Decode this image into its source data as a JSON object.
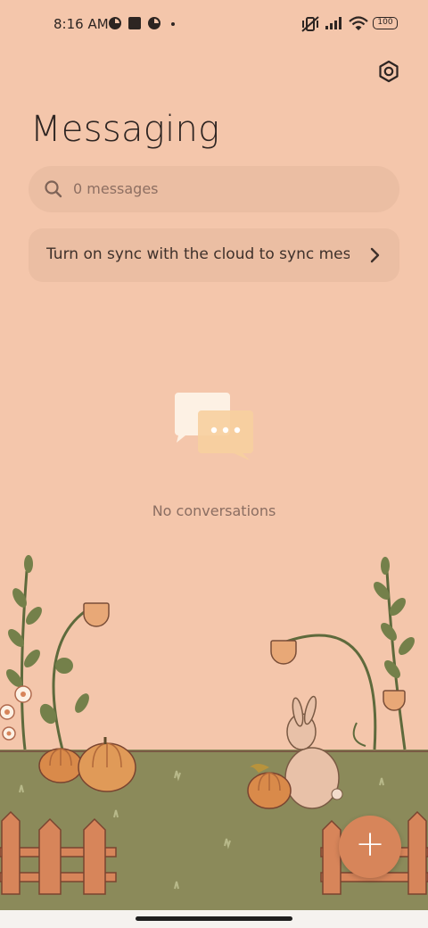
{
  "status_bar": {
    "time": "8:16 AM",
    "battery": "100"
  },
  "header": {
    "title": "Messaging"
  },
  "search": {
    "placeholder": "0 messages"
  },
  "sync_banner": {
    "text": "Turn on sync with the cloud to sync messag"
  },
  "empty_state": {
    "text": "No conversations"
  },
  "fab": {
    "label": "+"
  },
  "colors": {
    "background": "#f4c6ab",
    "card": "#ebbea3",
    "grass": "#8b8a5a",
    "fab": "#d7855a"
  },
  "icons": [
    "search-icon",
    "settings-icon",
    "chevron-right-icon",
    "chat-bubbles-icon",
    "plus-icon"
  ]
}
